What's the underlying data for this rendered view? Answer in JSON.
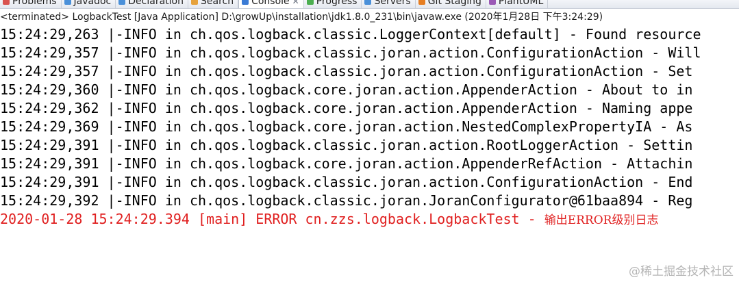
{
  "tabs": [
    {
      "label": "Problems",
      "icon": "problems-icon",
      "color": "#d9534f"
    },
    {
      "label": "Javadoc",
      "icon": "javadoc-icon",
      "color": "#4a90d9"
    },
    {
      "label": "Declaration",
      "icon": "declaration-icon",
      "color": "#4a90d9"
    },
    {
      "label": "Search",
      "icon": "search-icon",
      "color": "#e6a23c"
    },
    {
      "label": "Console",
      "icon": "console-icon",
      "color": "#3a7bd5",
      "active": true,
      "close": "✕"
    },
    {
      "label": "Progress",
      "icon": "progress-icon",
      "color": "#4caf50"
    },
    {
      "label": "Servers",
      "icon": "servers-icon",
      "color": "#4a90d9"
    },
    {
      "label": "Git Staging",
      "icon": "git-staging-icon",
      "color": "#e67e22"
    },
    {
      "label": "PlantUML",
      "icon": "plantuml-icon",
      "color": "#9b59b6"
    }
  ],
  "console": {
    "launch": "<terminated> LogbackTest [Java Application] D:\\growUp\\installation\\jdk1.8.0_231\\bin\\javaw.exe (2020年1月28日 下午3:24:29)",
    "lines": [
      "15:24:29,263 |-INFO in ch.qos.logback.classic.LoggerContext[default] - Found resource",
      "15:24:29,357 |-INFO in ch.qos.logback.classic.joran.action.ConfigurationAction - Will",
      "15:24:29,357 |-INFO in ch.qos.logback.classic.joran.action.ConfigurationAction - Set",
      "15:24:29,360 |-INFO in ch.qos.logback.core.joran.action.AppenderAction - About to in",
      "15:24:29,362 |-INFO in ch.qos.logback.core.joran.action.AppenderAction - Naming appe",
      "15:24:29,369 |-INFO in ch.qos.logback.core.joran.action.NestedComplexPropertyIA - As",
      "15:24:29,391 |-INFO in ch.qos.logback.classic.joran.action.RootLoggerAction - Settin",
      "15:24:29,391 |-INFO in ch.qos.logback.core.joran.action.AppenderRefAction - Attachin",
      "15:24:29,391 |-INFO in ch.qos.logback.classic.joran.action.ConfigurationAction - End",
      "15:24:29,392 |-INFO in ch.qos.logback.classic.joran.JoranConfigurator@61baa894 - Reg"
    ],
    "error_prefix": "2020-01-28 15:24:29.394 [main] ERROR cn.zzs.logback.LogbackTest - ",
    "error_message": "输出ERROR级别日志"
  },
  "colors": {
    "info_text": "#000000",
    "error_text": "#e02020"
  },
  "watermark": "@稀土掘金技术社区"
}
